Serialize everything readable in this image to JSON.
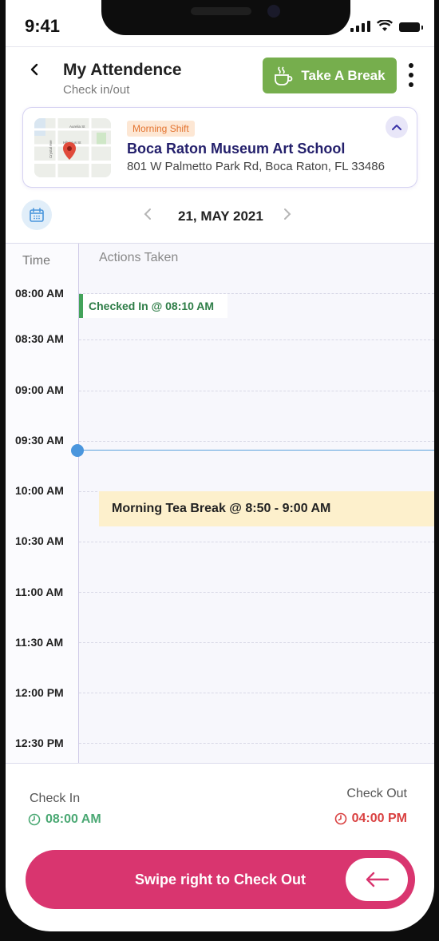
{
  "status_bar": {
    "time": "9:41"
  },
  "header": {
    "title": "My Attendence",
    "subtitle": "Check in/out",
    "break_button": "Take A Break",
    "icons": {
      "back": "chevron-left-icon",
      "break": "coffee-cup-icon",
      "more": "more-vertical-icon"
    }
  },
  "location": {
    "shift": "Morning Shift",
    "name": "Boca Raton Museum Art School",
    "address": "801 W Palmetto Park Rd, Boca Raton, FL 33486",
    "map_labels": [
      "Aurelia St",
      "Hibiscus St",
      "Crystal Ave"
    ]
  },
  "date": {
    "label": "21, MAY 2021"
  },
  "timeline": {
    "time_header": "Time",
    "actions_header": "Actions Taken",
    "slots": [
      "08:00 AM",
      "08:30 AM",
      "09:00 AM",
      "09:30 AM",
      "10:00 AM",
      "10:30 AM",
      "11:00 AM",
      "11:30 AM",
      "12:00 PM",
      "12:30 PM"
    ],
    "events": {
      "checkin": "Checked In @ 08:10 AM",
      "break": "Morning Tea  Break @ 8:50 - 9:00 AM"
    }
  },
  "summary": {
    "check_in_label": "Check In",
    "check_in_time": "08:00 AM",
    "check_out_label": "Check Out",
    "check_out_time": "04:00 PM"
  },
  "swipe": {
    "label": "Swipe right to Check Out"
  },
  "colors": {
    "accent_green": "#76ae4d",
    "swipe_pink": "#d9356f",
    "checkin_green": "#4aa873",
    "checkout_red": "#d94040",
    "navy": "#231f6b"
  }
}
